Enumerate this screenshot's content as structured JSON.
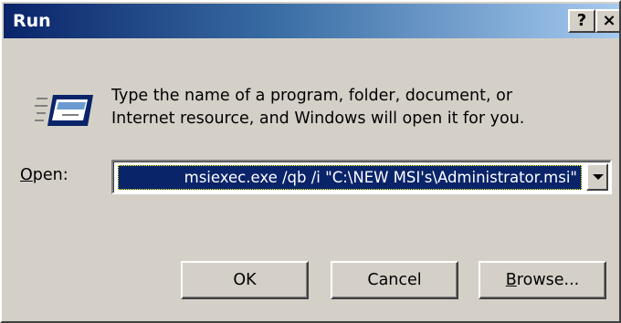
{
  "window": {
    "title": "Run",
    "help_button": "?",
    "close_button": "×"
  },
  "prompt": {
    "line1": "Type the name of a program, folder, document, or",
    "line2": "Internet resource, and Windows will open it for you."
  },
  "open": {
    "label_mnemonic": "O",
    "label_rest": "pen:",
    "value": "msiexec.exe /qb /i  \"C:\\NEW MSI's\\Administrator.msi\""
  },
  "buttons": {
    "ok": "OK",
    "cancel": "Cancel",
    "browse_mnemonic": "B",
    "browse_rest": "rowse..."
  },
  "colors": {
    "titlebar_start": "#0a246a",
    "titlebar_end": "#a6caf0",
    "dialog_face": "#d4d0c8",
    "selection": "#0a246a"
  },
  "icons": [
    "run-program-icon",
    "help-icon",
    "close-icon",
    "dropdown-arrow-icon"
  ]
}
